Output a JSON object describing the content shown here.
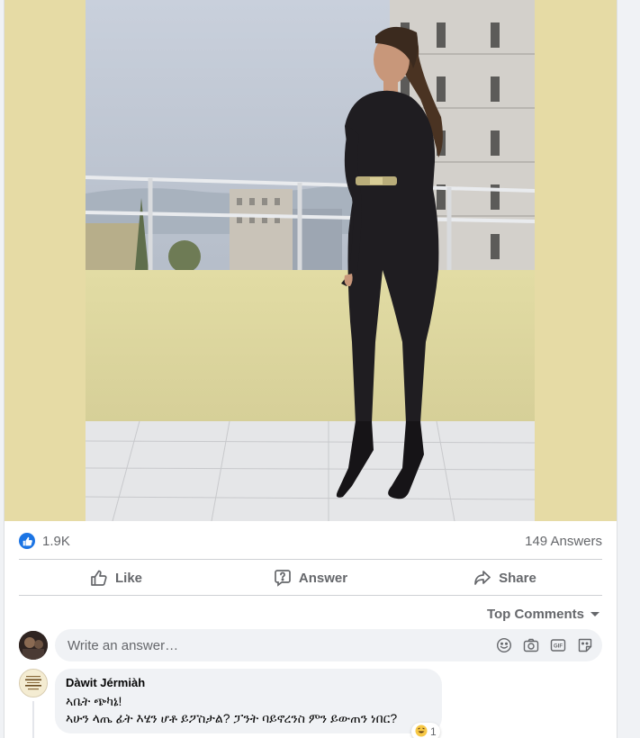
{
  "post": {
    "reactions_count": "1.9K",
    "answers_count": "149 Answers"
  },
  "actions": {
    "like_label": "Like",
    "answer_label": "Answer",
    "share_label": "Share"
  },
  "sort": {
    "label": "Top Comments"
  },
  "composer": {
    "placeholder": "Write an answer…"
  },
  "comment": {
    "author": "Dàwit Jérmiàh",
    "line1": "ኣቤት ጭካኔ!",
    "line2": "ኣሁን ላጤ ፊት እሄን ሆቶ ይፖስታል? ፓንት ባይኖረንስ ምን ይውጠን ነበር?",
    "reaction_count": "1"
  },
  "colors": {
    "accent": "#1b74e4",
    "photo_frame": "#e6dba5",
    "muted_text": "#65676b"
  }
}
